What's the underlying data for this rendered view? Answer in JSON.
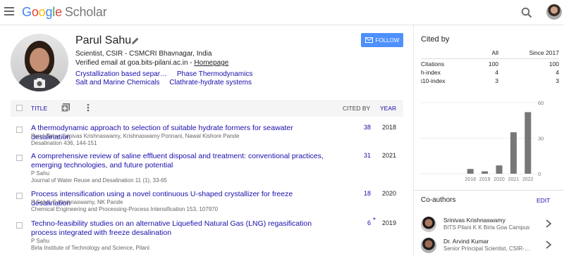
{
  "header": {
    "logo_parts": [
      "G",
      "o",
      "o",
      "g",
      "l",
      "e"
    ],
    "logo_suffix": "Scholar"
  },
  "profile": {
    "name": "Parul Sahu",
    "affiliation": "Scientist, CSIR - CSMCRI Bhavnagar, India",
    "email_text": "Verified email at goa.bits-pilani.ac.in - ",
    "homepage_label": "Homepage",
    "interests": [
      "Crystallization based separ…",
      "Phase Thermodynamics",
      "Salt and Marine Chemicals",
      "Clathrate-hydrate systems"
    ],
    "follow_label": "FOLLOW"
  },
  "table": {
    "title_header": "TITLE",
    "cited_by_header": "CITED BY",
    "year_header": "YEAR",
    "rows": [
      {
        "title": "A thermodynamic approach to selection of suitable hydrate formers for seawater desalination",
        "authors": "Parul Sahu, Srinivas Krishnaswamy, Krishnaswamy Ponnani, Nawal Kishore Pande",
        "venue": "Desalination 436, 144-151",
        "cited_by": "38",
        "star": "",
        "year": "2018"
      },
      {
        "title": "A comprehensive review of saline effluent disposal and treatment: conventional practices, emerging technologies, and future potential",
        "authors": "P Sahu",
        "venue": "Journal of Water Reuse and Desalination 11 (1), 33-65",
        "cited_by": "31",
        "star": "",
        "year": "2021"
      },
      {
        "title": "Process intensification using a novel continuous U-shaped crystallizer for freeze desalination",
        "authors": "P Sahu, S Krishnaswamy, NK Pande",
        "venue": "Chemical Engineering and Processing-Process Intensification 153, 107970",
        "cited_by": "18",
        "star": "",
        "year": "2020"
      },
      {
        "title": "Techno-feasibility studies on an alternative Liquefied Natural Gas (LNG) regasification process integrated with freeze desalination",
        "authors": "P Sahu",
        "venue": "Birla Institute of Technology and Science, Pilani",
        "cited_by": "6",
        "star": "*",
        "year": "2019"
      }
    ]
  },
  "cited_by": {
    "heading": "Cited by",
    "col_all": "All",
    "col_since": "Since 2017",
    "metrics": [
      {
        "label": "Citations",
        "all": "100",
        "since": "100"
      },
      {
        "label": "h-index",
        "all": "4",
        "since": "4"
      },
      {
        "label": "i10-index",
        "all": "3",
        "since": "3"
      }
    ]
  },
  "chart_data": {
    "type": "bar",
    "categories": [
      "2018",
      "2019",
      "2020",
      "2021",
      "2022"
    ],
    "values": [
      4,
      2,
      7,
      35,
      52
    ],
    "yticks": [
      "0",
      "30",
      "60"
    ],
    "ylim": [
      0,
      60
    ],
    "bar_color": "#777777"
  },
  "coauthors": {
    "heading": "Co-authors",
    "edit_label": "EDIT",
    "items": [
      {
        "name": "Srinivas Krishnaswamy",
        "affiliation": "BITS Pilani K K Birla Goa Campus"
      },
      {
        "name": "Dr. Arvind Kumar",
        "affiliation": "Senior Principal Scientist, CSIR-…"
      }
    ]
  },
  "colors": {
    "link": "#1a0dab",
    "follow_button": "#4d90fe"
  }
}
